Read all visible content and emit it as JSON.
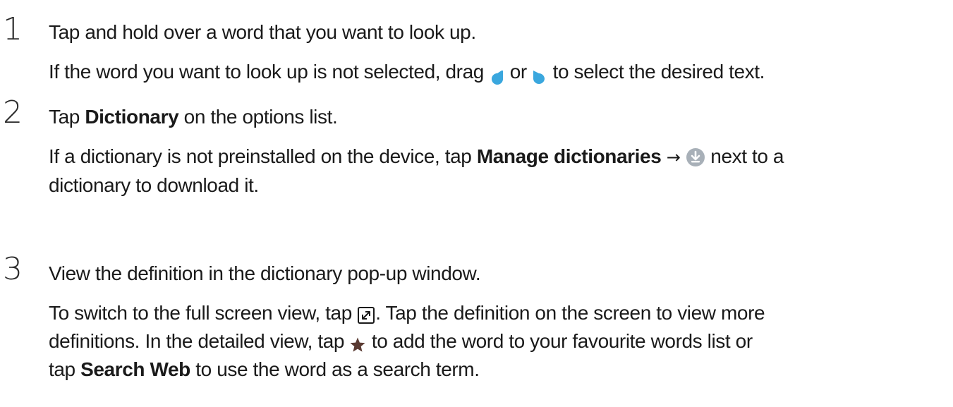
{
  "steps": [
    {
      "number": "1",
      "title": "Tap and hold over a word that you want to look up.",
      "desc": {
        "prefix": "If the word you want to look up is not selected, drag ",
        "middle": " or ",
        "suffix": " to select the desired text."
      },
      "icons": [
        "left-selection-handle-icon",
        "right-selection-handle-icon"
      ]
    },
    {
      "number": "2",
      "title": {
        "prefix": "Tap ",
        "bold": "Dictionary",
        "suffix": " on the options list."
      },
      "desc": {
        "prefix": "If a dictionary is not preinstalled on the device, tap ",
        "bold": "Manage dictionaries",
        "arrow": "→",
        "suffix": " next to a",
        "line2": "dictionary to download it."
      },
      "icons": [
        "download-icon"
      ]
    },
    {
      "number": "3",
      "title": "View the definition in the dictionary pop-up window.",
      "desc": {
        "line1_prefix": "To switch to the full screen view, tap ",
        "line1_suffix": ". Tap the definition on the screen to view more",
        "line2_prefix": "definitions. In the detailed view,  tap ",
        "line2_suffix": "  to add the word to your favourite words list or",
        "line3_prefix": "tap ",
        "line3_bold": "Search Web",
        "line3_suffix": " to use the word as a search term."
      },
      "icons": [
        "expand-icon",
        "star-icon"
      ]
    }
  ],
  "colors": {
    "text": "#1a1a1a",
    "handle_blue": "#3aa7de",
    "download_grey": "#a8b0b8",
    "star_brown": "#5a3a32"
  }
}
